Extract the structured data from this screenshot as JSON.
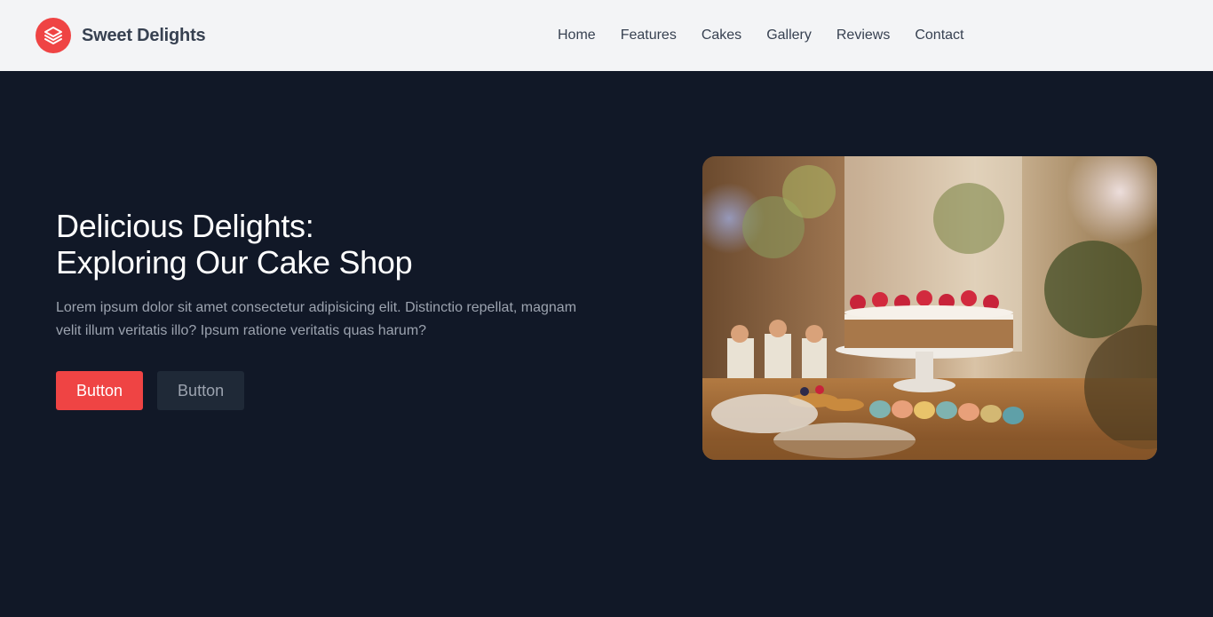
{
  "brand": {
    "name": "Sweet Delights",
    "logo_icon": "layers-icon",
    "logo_color": "#ef4444"
  },
  "nav": {
    "items": [
      {
        "label": "Home"
      },
      {
        "label": "Features"
      },
      {
        "label": "Cakes"
      },
      {
        "label": "Gallery"
      },
      {
        "label": "Reviews"
      },
      {
        "label": "Contact"
      }
    ]
  },
  "hero": {
    "title_line1": "Delicious Delights:",
    "title_line2": "Exploring Our Cake Shop",
    "description": "Lorem ipsum dolor sit amet consectetur adipisicing elit. Distinctio repellat, magnam velit illum veritatis illo? Ipsum ratione veritatis quas harum?",
    "primary_button": "Button",
    "secondary_button": "Button",
    "image_subject": "cake-display-photo"
  },
  "colors": {
    "navbar_bg": "#f3f4f6",
    "page_bg": "#111827",
    "accent": "#ef4444",
    "secondary_button_bg": "#1f2937"
  }
}
